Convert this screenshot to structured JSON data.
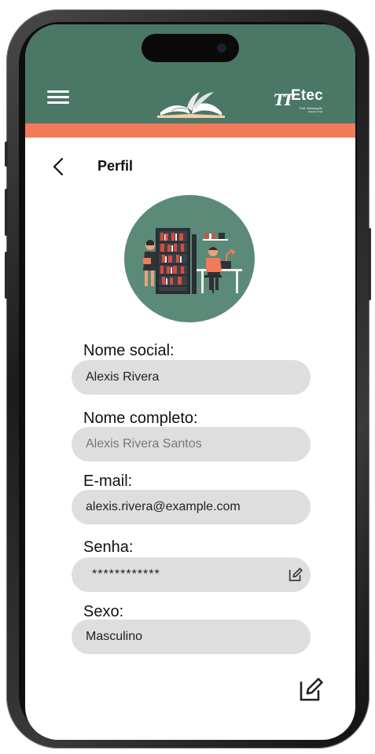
{
  "header": {
    "menu_icon": "hamburger-menu-icon",
    "logo_icon": "open-book-logo",
    "brand": {
      "name": "Etec",
      "sub1": "Prof. Massuyuki",
      "sub2": "Kawano Tupã"
    },
    "colors": {
      "header": "#4a7766",
      "stripe": "#f37a5a",
      "field": "#dedede",
      "avatar_bg": "#5b8a78"
    }
  },
  "page": {
    "title": "Perfil",
    "back_icon": "chevron-left-icon"
  },
  "form": {
    "social_name": {
      "label": "Nome social:",
      "value": "Alexis Rivera"
    },
    "full_name": {
      "label": "Nome completo:",
      "value": "Alexis Rivera Santos"
    },
    "email": {
      "label": "E-mail:",
      "value": "alexis.rivera@example.com"
    },
    "password": {
      "label": "Senha:",
      "value": "************",
      "edit_icon": "edit-icon"
    },
    "gender": {
      "label": "Sexo:",
      "value": "Masculino"
    }
  },
  "actions": {
    "edit_icon": "edit-profile-icon"
  }
}
